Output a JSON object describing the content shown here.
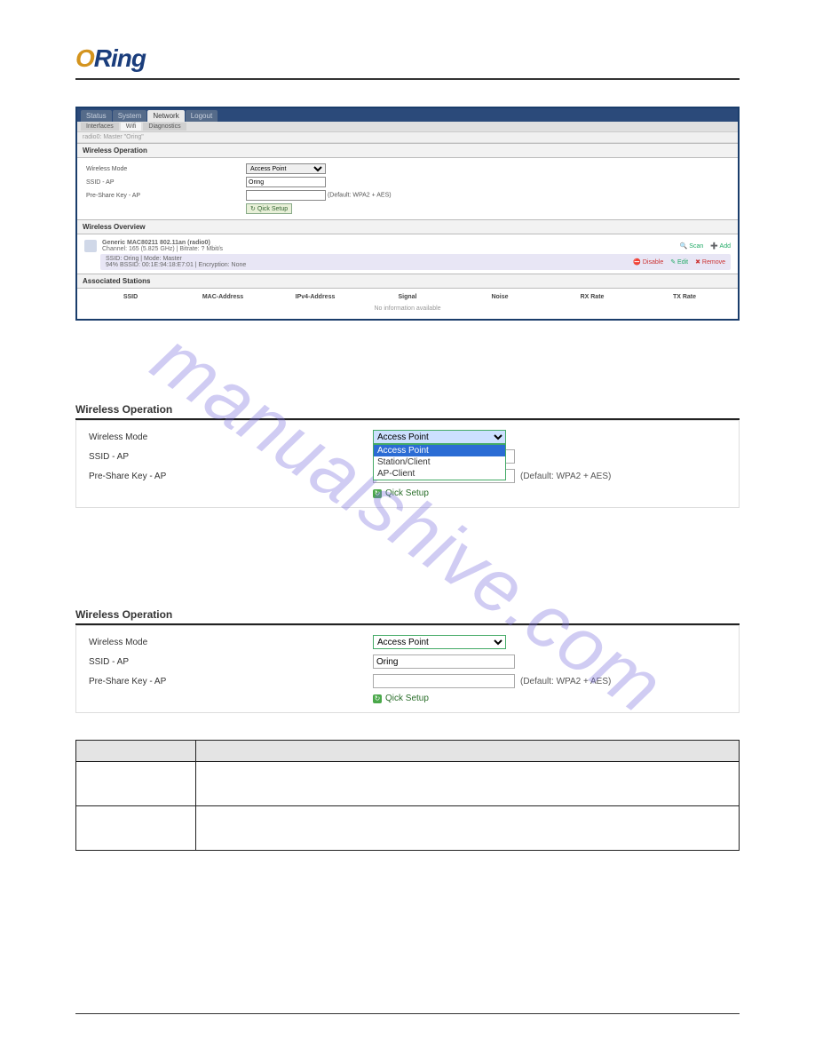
{
  "logo": {
    "prefix": "O",
    "rest": "Ring"
  },
  "watermark": "manualshive.com",
  "tabs": {
    "t1": "Status",
    "t2": "System",
    "t3": "Network",
    "t4": "Logout"
  },
  "subtabs": {
    "s1": "Interfaces",
    "s2": "Wifi",
    "s3": "Diagnostics"
  },
  "crumb": "radio0: Master \"Oring\"",
  "section1": "Wireless Operation",
  "section2": "Wireless Overview",
  "section3": "Associated Stations",
  "form": {
    "mode_label": "Wireless Mode",
    "mode_value": "Access Point",
    "ssid_label": "SSID - AP",
    "ssid_value": "Oring",
    "psk_label": "Pre-Share Key - AP",
    "psk_default": "(Default: WPA2 + AES)",
    "btn": "Qick Setup"
  },
  "overview": {
    "title": "Generic MAC80211 802.11an (radio0)",
    "detail": "Channel: 165 (5.825 GHz) | Bitrate: ? Mbit/s",
    "row2": "SSID: Oring | Mode: Master",
    "row2b": "94% BSSID: 00:1E:94:18:E7:01 | Encryption: None",
    "scan": "Scan",
    "add": "Add",
    "disable": "Disable",
    "edit": "Edit",
    "remove": "Remove"
  },
  "assoc_cols": {
    "c1": "SSID",
    "c2": "MAC-Address",
    "c3": "IPv4-Address",
    "c4": "Signal",
    "c5": "Noise",
    "c6": "RX Rate",
    "c7": "TX Rate"
  },
  "noinfo": "No information available",
  "dropdown": {
    "selected": "Access Point",
    "o1": "Access Point",
    "o2": "Station/Client",
    "o3": "AP-Client"
  },
  "panel2": {
    "head": "Wireless Operation",
    "mode_label": "Wireless Mode",
    "ssid_label": "SSID - AP",
    "psk_label": "Pre-Share Key - AP",
    "default": "(Default: WPA2 + AES)",
    "btn": "Qick Setup"
  },
  "panel3": {
    "head": "Wireless Operation",
    "mode_label": "Wireless Mode",
    "mode_value": "Access Point",
    "ssid_label": "SSID - AP",
    "ssid_value": "Oring",
    "psk_label": "Pre-Share Key - AP",
    "default": "(Default: WPA2 + AES)",
    "btn": "Qick Setup"
  },
  "footer": {
    "left": "",
    "right": ""
  }
}
